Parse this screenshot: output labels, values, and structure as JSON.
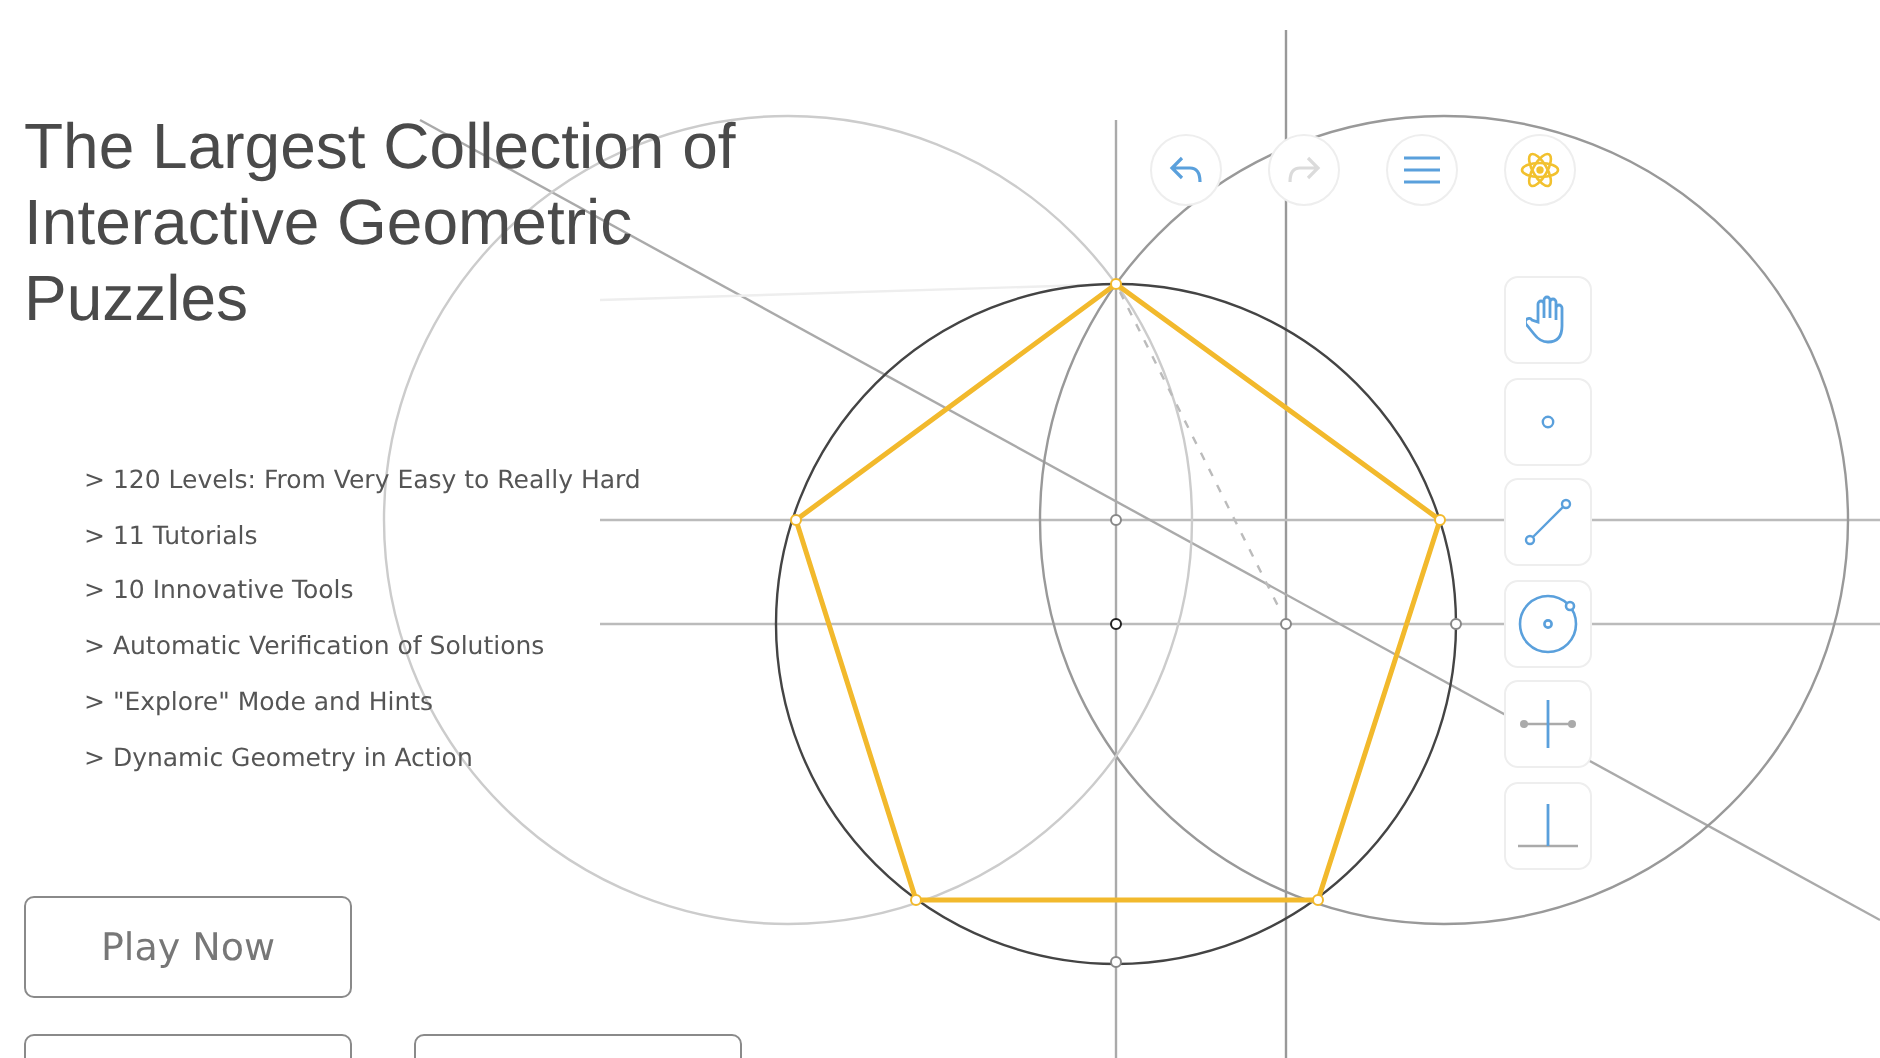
{
  "headline": "The Largest Collection of Interactive Geometric Puzzles",
  "features": [
    "> 120 Levels: From Very Easy to Really Hard",
    "> 11 Tutorials",
    "> 10 Innovative Tools",
    "> Automatic Verification of Solutions",
    "> \"Explore\" Mode and Hints",
    "> Dynamic Geometry in Action"
  ],
  "buttons": [
    {
      "kind": "labeled",
      "label": "Play Now"
    },
    {
      "kind": "cropped"
    },
    {
      "kind": "cropped"
    }
  ],
  "top_controls": [
    {
      "kind": "undo",
      "disabled": false
    },
    {
      "kind": "redo",
      "disabled": true
    },
    {
      "kind": "menu",
      "disabled": false
    },
    {
      "kind": "atom",
      "disabled": false
    }
  ],
  "tools": [
    {
      "kind": "hand"
    },
    {
      "kind": "point"
    },
    {
      "kind": "segment"
    },
    {
      "kind": "circle"
    },
    {
      "kind": "bisector"
    },
    {
      "kind": "perpendicular"
    }
  ]
}
